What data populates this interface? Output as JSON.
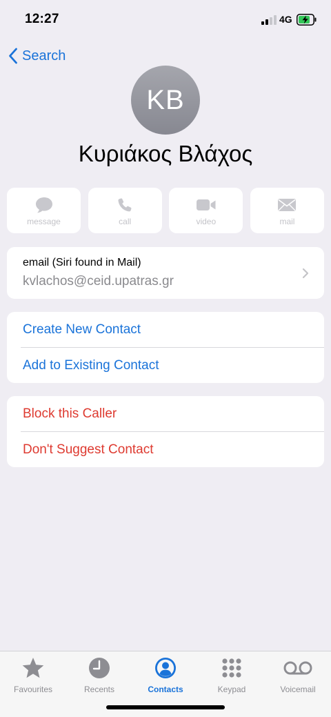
{
  "status": {
    "time": "12:27",
    "network": "4G"
  },
  "nav": {
    "back_label": "Search"
  },
  "contact": {
    "initials": "KB",
    "name": "Κυριάκος Βλάχος"
  },
  "actions": [
    {
      "label": "message",
      "icon": "message-icon"
    },
    {
      "label": "call",
      "icon": "phone-icon"
    },
    {
      "label": "video",
      "icon": "video-icon"
    },
    {
      "label": "mail",
      "icon": "mail-icon"
    }
  ],
  "email": {
    "label": "email (Siri found in Mail)",
    "value": "kvlachos@ceid.upatras.gr"
  },
  "contact_options": [
    "Create New Contact",
    "Add to Existing Contact"
  ],
  "caller_options": [
    "Block this Caller",
    "Don't Suggest Contact"
  ],
  "tabs": [
    {
      "label": "Favourites",
      "icon": "star-icon"
    },
    {
      "label": "Recents",
      "icon": "clock-icon"
    },
    {
      "label": "Contacts",
      "icon": "person-circle-icon",
      "active": true
    },
    {
      "label": "Keypad",
      "icon": "keypad-icon"
    },
    {
      "label": "Voicemail",
      "icon": "voicemail-icon"
    }
  ],
  "colors": {
    "accent": "#1a73d9",
    "destructive": "#de3a30",
    "background": "#efedf3",
    "disabled": "#c3c3c8",
    "battery_charging": "#34c759"
  }
}
